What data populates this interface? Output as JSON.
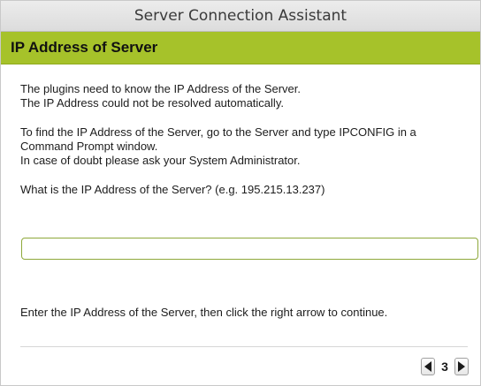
{
  "window": {
    "title": "Server Connection Assistant"
  },
  "section": {
    "header": "IP Address of Server"
  },
  "content": {
    "paragraph1": [
      "The plugins need to know the IP Address of the Server.",
      "The IP Address could not be resolved automatically."
    ],
    "paragraph2": [
      "To find the IP Address of the Server, go to the Server and type IPCONFIG in a",
      "Command Prompt window.",
      "In case of doubt please ask your System Administrator."
    ],
    "question": "What is the IP Address of the Server? (e.g. 195.215.13.237)"
  },
  "ip_input": {
    "value": "",
    "placeholder": ""
  },
  "footer": {
    "instruction": "Enter the IP Address of the Server, then click the right arrow to continue."
  },
  "pager": {
    "page_number": "3",
    "prev_icon": "triangle-left-icon",
    "next_icon": "triangle-right-icon"
  },
  "colors": {
    "accent": "#a6c22a",
    "input_border": "#8ea83a"
  }
}
